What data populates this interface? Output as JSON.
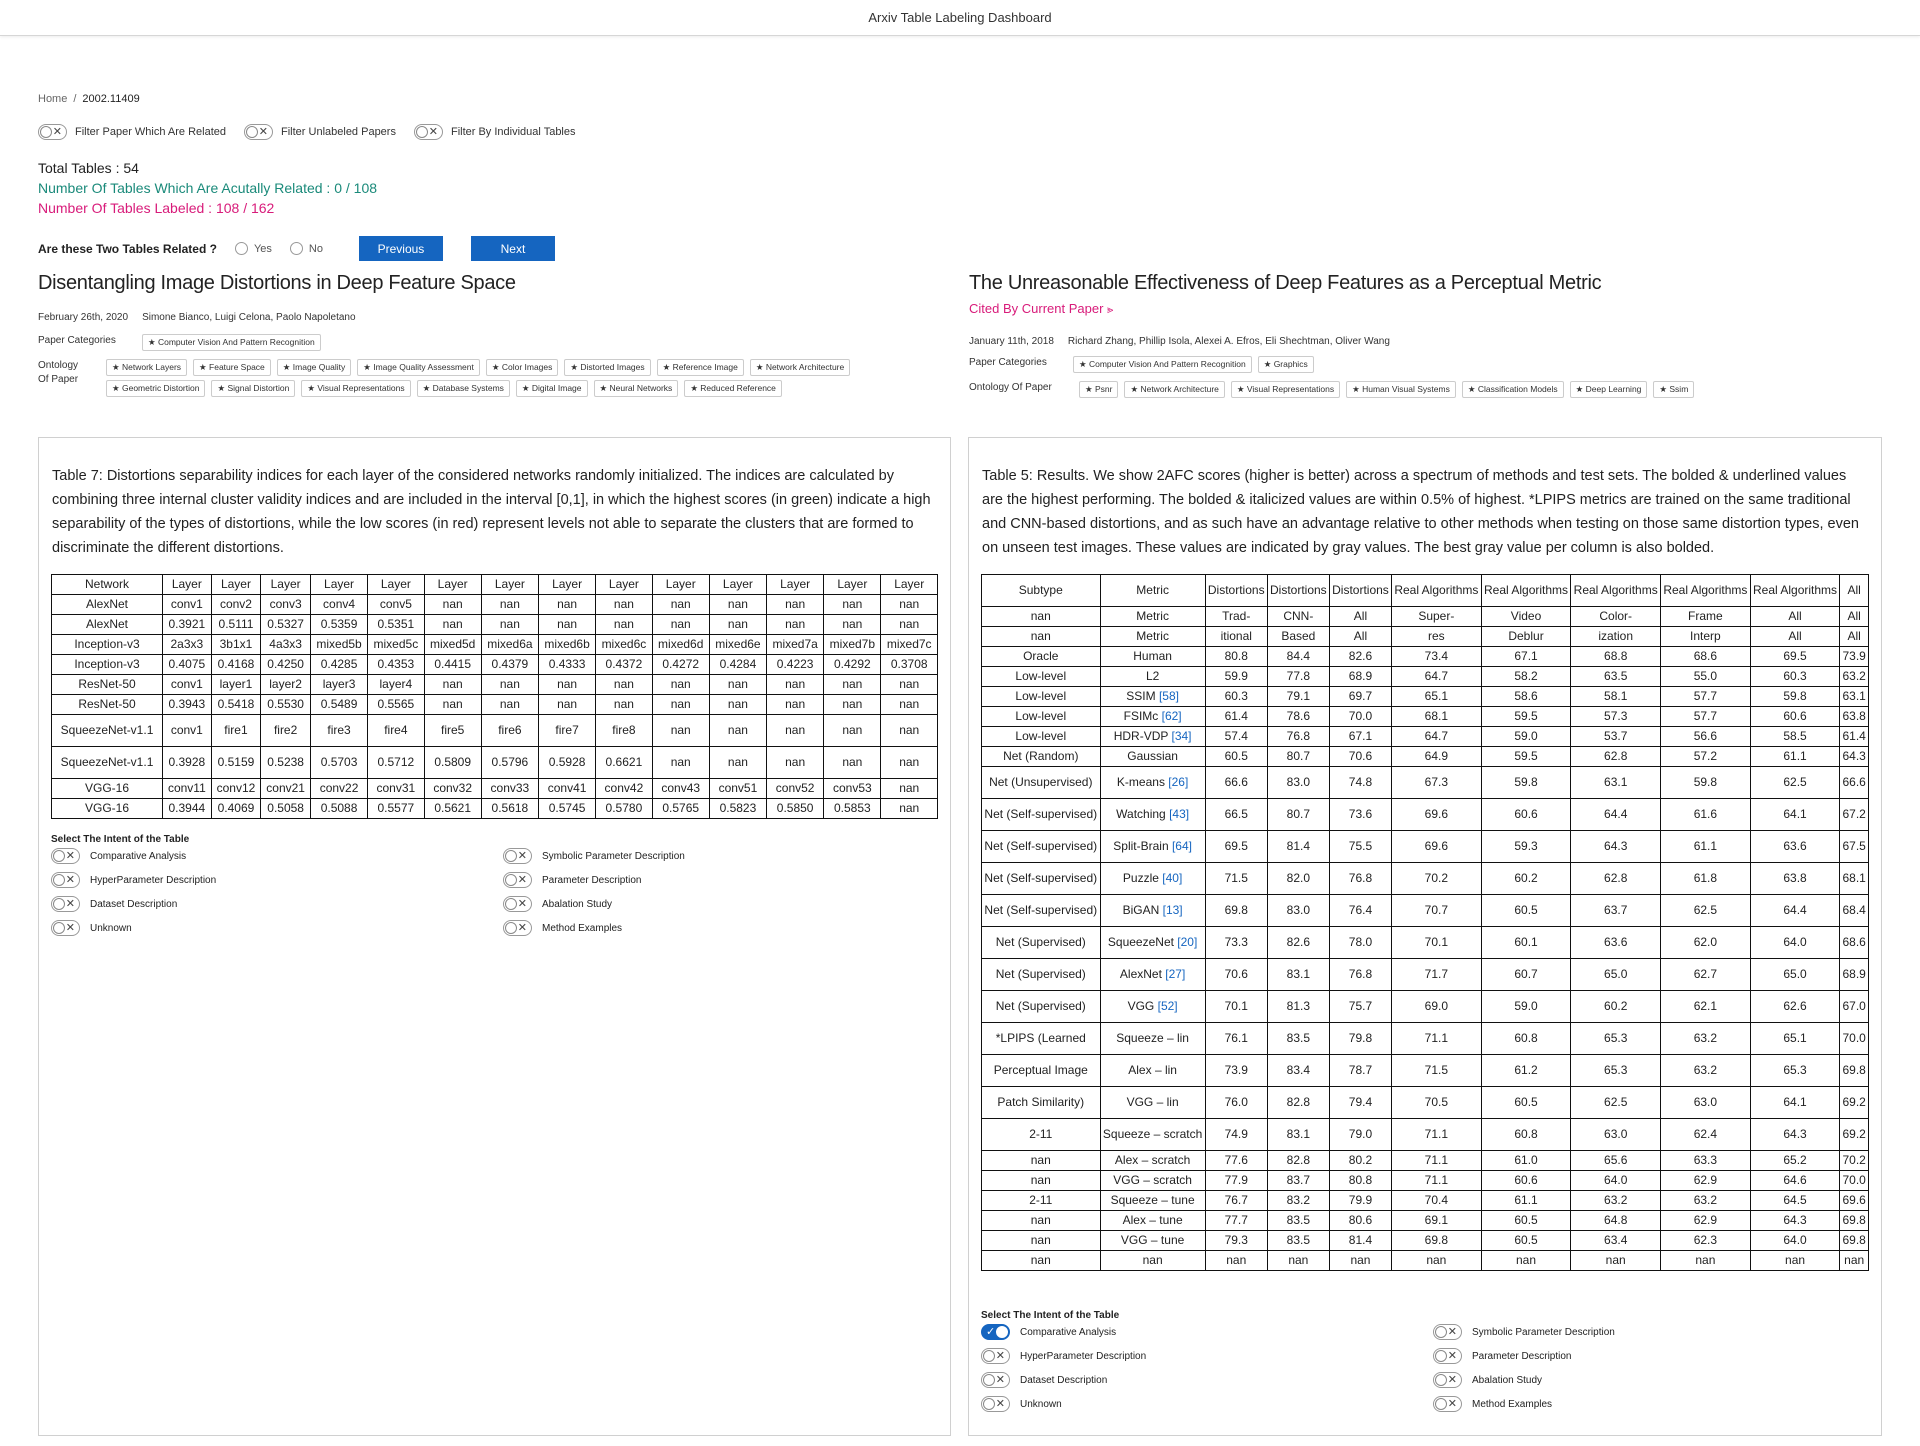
{
  "app": {
    "title": "Arxiv Table Labeling Dashboard"
  },
  "breadcrumb": {
    "home": "Home",
    "separator": "/",
    "current": "2002.11409"
  },
  "filters": [
    {
      "label": "Filter Paper Which Are Related",
      "on": false
    },
    {
      "label": "Filter Unlabeled Papers",
      "on": false
    },
    {
      "label": "Filter By Individual Tables",
      "on": false
    }
  ],
  "stats": {
    "total": "Total Tables : 54",
    "related": "Number Of Tables Which Are Acutally Related : 0 / 108",
    "labeled": "Number Of Tables Labeled : 108 / 162"
  },
  "question": {
    "text": "Are these Two Tables Related ?",
    "yes": "Yes",
    "no": "No",
    "previous": "Previous",
    "next": "Next"
  },
  "left_paper": {
    "title": "Disentangling Image Distortions in Deep Feature Space",
    "date": "February 26th, 2020",
    "authors": "Simone Bianco, Luigi Celona, Paolo Napoletano",
    "categories_label": "Paper Categories",
    "categories": [
      "Computer Vision And Pattern Recognition"
    ],
    "ontology_label_1": "Ontology",
    "ontology_label_2": "Of Paper",
    "ontology": [
      "Network Layers",
      "Feature Space",
      "Image Quality",
      "Image Quality Assessment",
      "Color Images",
      "Distorted Images",
      "Reference Image",
      "Network Architecture",
      "Geometric Distortion",
      "Signal Distortion",
      "Visual Representations",
      "Database Systems",
      "Digital Image",
      "Neural Networks",
      "Reduced Reference"
    ]
  },
  "right_paper": {
    "title": "The Unreasonable Effectiveness of Deep Features as a Perceptual Metric",
    "cited": "Cited By Current Paper",
    "date": "January 11th, 2018",
    "authors": "Richard Zhang, Phillip Isola, Alexei A. Efros, Eli Shechtman, Oliver Wang",
    "categories_label": "Paper Categories",
    "categories": [
      "Computer Vision And Pattern Recognition",
      "Graphics"
    ],
    "ontology_label": "Ontology Of Paper",
    "ontology": [
      "Psnr",
      "Network Architecture",
      "Visual Representations",
      "Human Visual Systems",
      "Classification Models",
      "Deep Learning",
      "Ssim"
    ]
  },
  "left_table": {
    "caption": "Table 7: Distortions separability indices for each layer of the considered networks randomly initialized. The indices are calculated by combining three internal cluster validity indices and are included in the interval [0,1], in which the highest scores (in green) indicate a high separability of the types of distortions, while the low scores (in red) represent levels not able to separate the clusters that are formed to discriminate the different distortions.",
    "rows": [
      [
        "Network",
        "Layer",
        "Layer",
        "Layer",
        "Layer",
        "Layer",
        "Layer",
        "Layer",
        "Layer",
        "Layer",
        "Layer",
        "Layer",
        "Layer",
        "Layer",
        "Layer"
      ],
      [
        "AlexNet",
        "conv1",
        "conv2",
        "conv3",
        "conv4",
        "conv5",
        "nan",
        "nan",
        "nan",
        "nan",
        "nan",
        "nan",
        "nan",
        "nan",
        "nan"
      ],
      [
        "AlexNet",
        "0.3921",
        "0.5111",
        "0.5327",
        "0.5359",
        "0.5351",
        "nan",
        "nan",
        "nan",
        "nan",
        "nan",
        "nan",
        "nan",
        "nan",
        "nan"
      ],
      [
        "Inception-v3",
        "2a3x3",
        "3b1x1",
        "4a3x3",
        "mixed5b",
        "mixed5c",
        "mixed5d",
        "mixed6a",
        "mixed6b",
        "mixed6c",
        "mixed6d",
        "mixed6e",
        "mixed7a",
        "mixed7b",
        "mixed7c"
      ],
      [
        "Inception-v3",
        "0.4075",
        "0.4168",
        "0.4250",
        "0.4285",
        "0.4353",
        "0.4415",
        "0.4379",
        "0.4333",
        "0.4372",
        "0.4272",
        "0.4284",
        "0.4223",
        "0.4292",
        "0.3708"
      ],
      [
        "ResNet-50",
        "conv1",
        "layer1",
        "layer2",
        "layer3",
        "layer4",
        "nan",
        "nan",
        "nan",
        "nan",
        "nan",
        "nan",
        "nan",
        "nan",
        "nan"
      ],
      [
        "ResNet-50",
        "0.3943",
        "0.5418",
        "0.5530",
        "0.5489",
        "0.5565",
        "nan",
        "nan",
        "nan",
        "nan",
        "nan",
        "nan",
        "nan",
        "nan",
        "nan"
      ],
      [
        "SqueezeNet-v1.1",
        "conv1",
        "fire1",
        "fire2",
        "fire3",
        "fire4",
        "fire5",
        "fire6",
        "fire7",
        "fire8",
        "nan",
        "nan",
        "nan",
        "nan",
        "nan"
      ],
      [
        "SqueezeNet-v1.1",
        "0.3928",
        "0.5159",
        "0.5238",
        "0.5703",
        "0.5712",
        "0.5809",
        "0.5796",
        "0.5928",
        "0.6621",
        "nan",
        "nan",
        "nan",
        "nan",
        "nan"
      ],
      [
        "VGG-16",
        "conv11",
        "conv12",
        "conv21",
        "conv22",
        "conv31",
        "conv32",
        "conv33",
        "conv41",
        "conv42",
        "conv43",
        "conv51",
        "conv52",
        "conv53",
        "nan"
      ],
      [
        "VGG-16",
        "0.3944",
        "0.4069",
        "0.5058",
        "0.5088",
        "0.5577",
        "0.5621",
        "0.5618",
        "0.5745",
        "0.5780",
        "0.5765",
        "0.5823",
        "0.5850",
        "0.5853",
        "nan"
      ]
    ]
  },
  "right_table": {
    "caption": "Table 5: Results. We show 2AFC scores (higher is better) across a spectrum of methods and test sets. The bolded & underlined values are the highest performing. The bolded & italicized values are within 0.5% of highest. *LPIPS metrics are trained on the same traditional and CNN-based distortions, and as such have an advantage relative to other methods when testing on those same distortion types, even on unseen test images. These values are indicated by gray values. The best gray value per column is also bolded.",
    "rows": [
      [
        "Subtype",
        "Metric",
        "Distortions",
        "Distortions",
        "Distortions",
        "Real Algorithms",
        "Real Algorithms",
        "Real Algorithms",
        "Real Algorithms",
        "Real Algorithms",
        "All"
      ],
      [
        "nan",
        "Metric",
        "Trad-",
        "CNN-",
        "All",
        "Super-",
        "Video",
        "Color-",
        "Frame",
        "All",
        "All"
      ],
      [
        "nan",
        "Metric",
        "itional",
        "Based",
        "All",
        "res",
        "Deblur",
        "ization",
        "Interp",
        "All",
        "All"
      ],
      [
        "Oracle",
        "Human",
        "80.8",
        "84.4",
        "82.6",
        "73.4",
        "67.1",
        "68.8",
        "68.6",
        "69.5",
        "73.9"
      ],
      [
        "Low-level",
        "L2",
        "59.9",
        "77.8",
        "68.9",
        "64.7",
        "58.2",
        "63.5",
        "55.0",
        "60.3",
        "63.2"
      ],
      [
        "Low-level",
        "SSIM [58]",
        "60.3",
        "79.1",
        "69.7",
        "65.1",
        "58.6",
        "58.1",
        "57.7",
        "59.8",
        "63.1"
      ],
      [
        "Low-level",
        "FSIMc [62]",
        "61.4",
        "78.6",
        "70.0",
        "68.1",
        "59.5",
        "57.3",
        "57.7",
        "60.6",
        "63.8"
      ],
      [
        "Low-level",
        "HDR-VDP [34]",
        "57.4",
        "76.8",
        "67.1",
        "64.7",
        "59.0",
        "53.7",
        "56.6",
        "58.5",
        "61.4"
      ],
      [
        "Net (Random)",
        "Gaussian",
        "60.5",
        "80.7",
        "70.6",
        "64.9",
        "59.5",
        "62.8",
        "57.2",
        "61.1",
        "64.3"
      ],
      [
        "Net (Unsupervised)",
        "K-means [26]",
        "66.6",
        "83.0",
        "74.8",
        "67.3",
        "59.8",
        "63.1",
        "59.8",
        "62.5",
        "66.6"
      ],
      [
        "Net (Self-supervised)",
        "Watching [43]",
        "66.5",
        "80.7",
        "73.6",
        "69.6",
        "60.6",
        "64.4",
        "61.6",
        "64.1",
        "67.2"
      ],
      [
        "Net (Self-supervised)",
        "Split-Brain [64]",
        "69.5",
        "81.4",
        "75.5",
        "69.6",
        "59.3",
        "64.3",
        "61.1",
        "63.6",
        "67.5"
      ],
      [
        "Net (Self-supervised)",
        "Puzzle [40]",
        "71.5",
        "82.0",
        "76.8",
        "70.2",
        "60.2",
        "62.8",
        "61.8",
        "63.8",
        "68.1"
      ],
      [
        "Net (Self-supervised)",
        "BiGAN [13]",
        "69.8",
        "83.0",
        "76.4",
        "70.7",
        "60.5",
        "63.7",
        "62.5",
        "64.4",
        "68.4"
      ],
      [
        "Net (Supervised)",
        "SqueezeNet [20]",
        "73.3",
        "82.6",
        "78.0",
        "70.1",
        "60.1",
        "63.6",
        "62.0",
        "64.0",
        "68.6"
      ],
      [
        "Net (Supervised)",
        "AlexNet [27]",
        "70.6",
        "83.1",
        "76.8",
        "71.7",
        "60.7",
        "65.0",
        "62.7",
        "65.0",
        "68.9"
      ],
      [
        "Net (Supervised)",
        "VGG [52]",
        "70.1",
        "81.3",
        "75.7",
        "69.0",
        "59.0",
        "60.2",
        "62.1",
        "62.6",
        "67.0"
      ],
      [
        "*LPIPS (Learned",
        "Squeeze – lin",
        "76.1",
        "83.5",
        "79.8",
        "71.1",
        "60.8",
        "65.3",
        "63.2",
        "65.1",
        "70.0"
      ],
      [
        "Perceptual Image",
        "Alex – lin",
        "73.9",
        "83.4",
        "78.7",
        "71.5",
        "61.2",
        "65.3",
        "63.2",
        "65.3",
        "69.8"
      ],
      [
        "Patch Similarity)",
        "VGG – lin",
        "76.0",
        "82.8",
        "79.4",
        "70.5",
        "60.5",
        "62.5",
        "63.0",
        "64.1",
        "69.2"
      ],
      [
        "2-11",
        "Squeeze – scratch",
        "74.9",
        "83.1",
        "79.0",
        "71.1",
        "60.8",
        "63.0",
        "62.4",
        "64.3",
        "69.2"
      ],
      [
        "nan",
        "Alex – scratch",
        "77.6",
        "82.8",
        "80.2",
        "71.1",
        "61.0",
        "65.6",
        "63.3",
        "65.2",
        "70.2"
      ],
      [
        "nan",
        "VGG – scratch",
        "77.9",
        "83.7",
        "80.8",
        "71.1",
        "60.6",
        "64.0",
        "62.9",
        "64.6",
        "70.0"
      ],
      [
        "2-11",
        "Squeeze – tune",
        "76.7",
        "83.2",
        "79.9",
        "70.4",
        "61.1",
        "63.2",
        "63.2",
        "64.5",
        "69.6"
      ],
      [
        "nan",
        "Alex – tune",
        "77.7",
        "83.5",
        "80.6",
        "69.1",
        "60.5",
        "64.8",
        "62.9",
        "64.3",
        "69.8"
      ],
      [
        "nan",
        "VGG – tune",
        "79.3",
        "83.5",
        "81.4",
        "69.8",
        "60.5",
        "63.4",
        "62.3",
        "64.0",
        "69.8"
      ],
      [
        "nan",
        "nan",
        "nan",
        "nan",
        "nan",
        "nan",
        "nan",
        "nan",
        "nan",
        "nan",
        "nan"
      ]
    ]
  },
  "intent": {
    "heading": "Select The Intent of the Table",
    "options": [
      "Comparative Analysis",
      "Symbolic Parameter Description",
      "HyperParameter Description",
      "Parameter Description",
      "Dataset Description",
      "Abalation Study",
      "Unknown",
      "Method Examples"
    ],
    "left_selected": [],
    "right_selected": [
      "Comparative Analysis"
    ]
  }
}
